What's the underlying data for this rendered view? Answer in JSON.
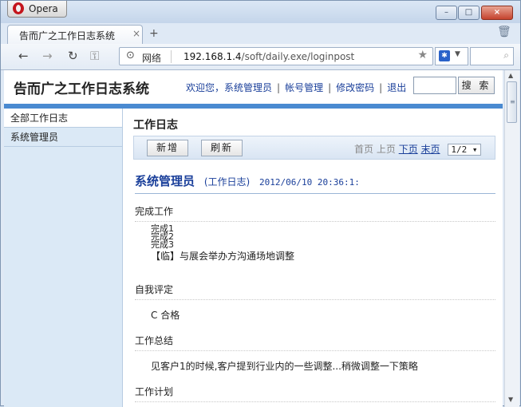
{
  "browser": {
    "app_name": "Opera",
    "tab_title": "告而广之工作日志系统",
    "tab_close": "×",
    "new_tab": "+",
    "address": {
      "network_label": "网络",
      "url_host": "192.168.1.4",
      "url_path": "/soft/daily.exe/loginpost"
    },
    "window_controls": {
      "minimize": "–",
      "maximize": "□",
      "close": "×"
    }
  },
  "site": {
    "title": "告而广之工作日志系统",
    "nav": {
      "welcome": "欢迎您，系统管理员",
      "sep": "|",
      "account": "帐号管理",
      "password": "修改密码",
      "logout": "退出"
    },
    "search_button": "搜 索"
  },
  "sidebar": {
    "items": [
      {
        "label": "全部工作日志",
        "active": true
      },
      {
        "label": "系统管理员",
        "active": false
      }
    ]
  },
  "main": {
    "title": "工作日志",
    "toolbar": {
      "add": "新增",
      "refresh": "刷新"
    },
    "pager": {
      "first": "首页",
      "prev": "上页",
      "next": "下页",
      "last": "末页",
      "page": "1/2 ▾"
    },
    "entry": {
      "author": "系统管理员",
      "type": "(工作日志)",
      "time": "2012/06/10 20:36:1:"
    },
    "sections": [
      {
        "label": "完成工作",
        "lines": [
          "完成1",
          "完成2",
          "完成3",
          "【临】与展会举办方沟通场地调整"
        ]
      },
      {
        "label": "自我评定",
        "lines": [
          "C 合格"
        ]
      },
      {
        "label": "工作总结",
        "lines": [
          "见客户1的时候,客户提到行业内的一些调整...稍微调整一下策略"
        ]
      },
      {
        "label": "工作计划",
        "lines": []
      }
    ]
  },
  "colors": {
    "accent": "#4a8ad1",
    "link": "#1a3f9a",
    "sidebar_bg": "#dbe9f6"
  }
}
